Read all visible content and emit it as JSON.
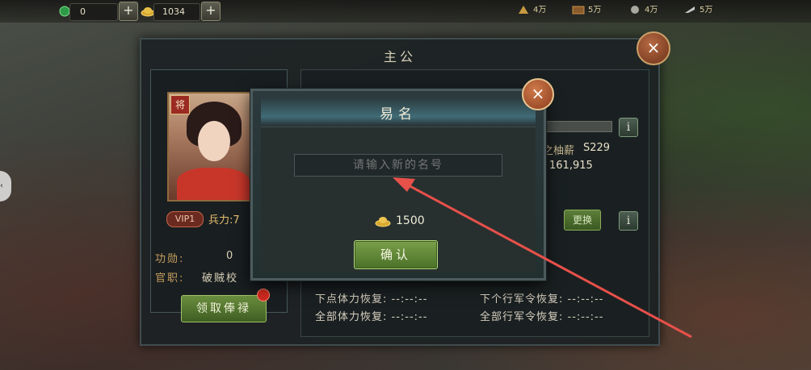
{
  "top_bar": {
    "jade_value": "0",
    "gold_value": "1034",
    "plus_label": "+",
    "stats": [
      {
        "icon": "grain-icon",
        "value": "4万"
      },
      {
        "icon": "wood-icon",
        "value": "5万"
      },
      {
        "icon": "stone-icon",
        "value": "4万"
      },
      {
        "icon": "iron-icon",
        "value": "5万"
      }
    ]
  },
  "main_panel": {
    "title": "主公",
    "close_label": "×",
    "portrait_badge": "将",
    "vip": "VIP1",
    "troops": "兵力:7",
    "merit_label": "功勋:",
    "merit_value": "0",
    "rank_label": "官职:",
    "rank_value": "破贼校",
    "reward_button": "领取俸禄",
    "salary_fragment": "之柚薪",
    "server": "S229",
    "power": "161,915",
    "swap_button": "更换",
    "info_label": "i",
    "recover_next_stamina": "下点体力恢复: --:--:--",
    "recover_all_stamina": "全部体力恢复: --:--:--",
    "recover_next_order": "下个行军令恢复: --:--:--",
    "recover_all_order": "全部行军令恢复: --:--:--"
  },
  "rename_dialog": {
    "title": "易名",
    "placeholder": "请输入新的名号",
    "cost": "1500",
    "confirm_button": "确认",
    "close_label": "×"
  },
  "colors": {
    "accent_green": "#6a8e3e",
    "close_orange": "#b56a44",
    "arrow_red": "#e8504a"
  }
}
